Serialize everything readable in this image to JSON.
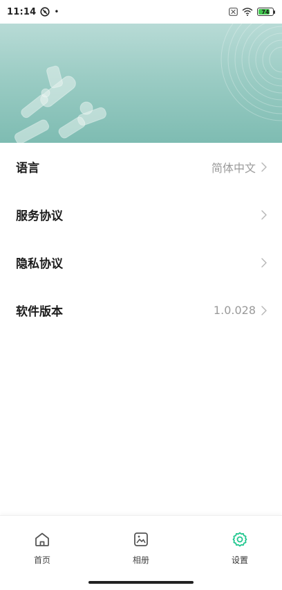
{
  "status_bar": {
    "time": "11:14",
    "dot": "•",
    "battery_level": "74",
    "battery_fraction": 0.74,
    "icons": [
      "vpn-icon",
      "close-box-icon",
      "wifi-icon",
      "battery-icon"
    ]
  },
  "settings": {
    "items": [
      {
        "label": "语言",
        "value": "简体中文"
      },
      {
        "label": "服务协议",
        "value": ""
      },
      {
        "label": "隐私协议",
        "value": ""
      },
      {
        "label": "软件版本",
        "value": "1.0.028"
      }
    ]
  },
  "bottom_nav": {
    "items": [
      {
        "label": "首页",
        "icon": "home-icon"
      },
      {
        "label": "相册",
        "icon": "gallery-icon"
      },
      {
        "label": "设置",
        "icon": "settings-icon",
        "active": true
      }
    ]
  },
  "colors": {
    "accent": "#21c78f",
    "hero_top": "#b8dbd6",
    "hero_bottom": "#7ebcb2",
    "battery_green": "#42c94f"
  }
}
